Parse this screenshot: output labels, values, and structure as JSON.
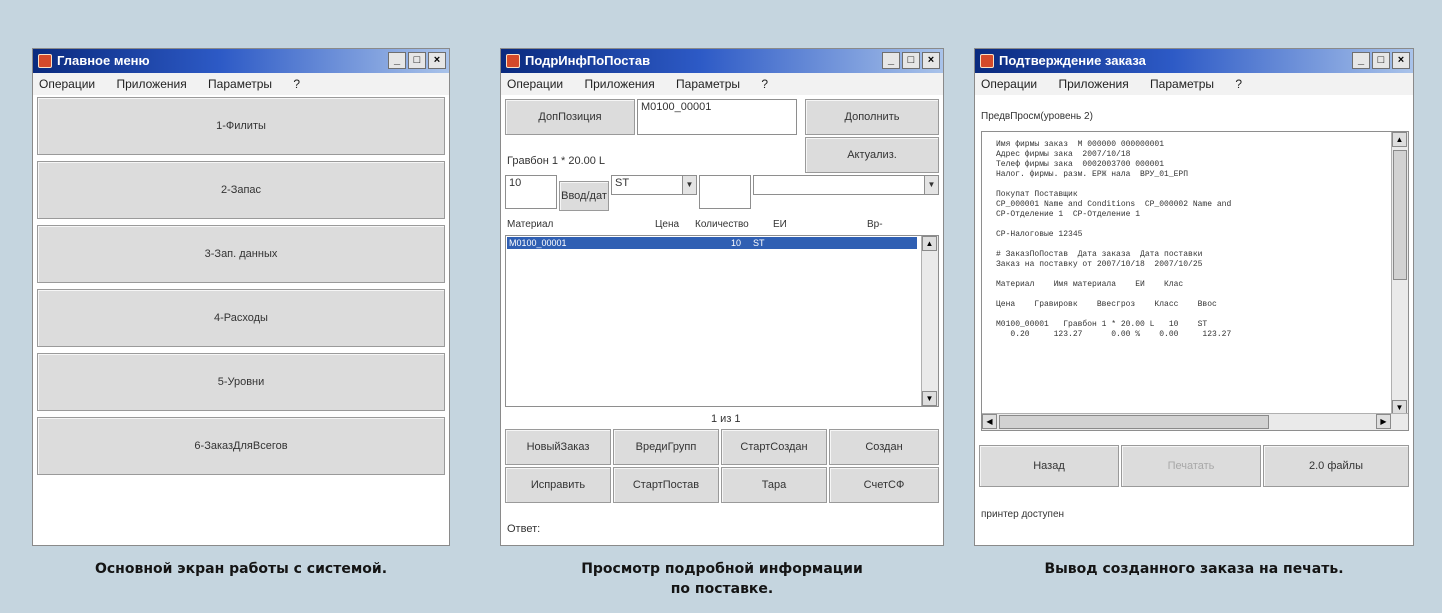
{
  "captions": {
    "main": "Основной экран работы с системой.",
    "details_line1": "Просмотр подробной информации",
    "details_line2": "по поставке.",
    "print": "Вывод созданного заказа на печать."
  },
  "main_window": {
    "title": "Главное меню",
    "menu": [
      "Операции",
      "Приложения",
      "Параметры",
      "?"
    ],
    "buttons": [
      "1-Филиты",
      "2-Запас",
      "3-Зап. данных",
      "4-Расходы",
      "5-Уровни",
      "6-ЗаказДляВсегов"
    ]
  },
  "details_window": {
    "title": "ПодрИнфПоПостав",
    "menu": [
      "Операции",
      "Приложения",
      "Параметры",
      "?"
    ],
    "btn_details": "ДопПозиция",
    "order_field": "M0100_00001",
    "btn_add": "Дополнить",
    "info_label": "Гравбон 1 * 20.00 L",
    "btn_update": "Актуализ.",
    "qty_field": "10",
    "btn_read": "Ввод/дат",
    "combo_value": "ST",
    "table_headers": [
      "Материал",
      "Цена",
      "Количество",
      "ЕИ",
      "Вр-"
    ],
    "table_rows": [
      {
        "material": "M0100_00001",
        "qty": "10",
        "unit": "ST"
      }
    ],
    "pager": "1 из 1",
    "actions_row1": [
      "НовыйЗаказ",
      "ВредиГрупп",
      "СтартСоздан",
      "Создан"
    ],
    "actions_row2": [
      "Исправить",
      "СтартПостав",
      "Тара",
      "СчетСФ"
    ],
    "status": "Ответ:"
  },
  "print_window": {
    "title": "Подтверждение заказа",
    "menu": [
      "Операции",
      "Приложения",
      "Параметры",
      "?"
    ],
    "label_top": "ПредвПросм(уровень 2)",
    "report_lines": [
      "Имя фирмы заказ  M 000000 000000001",
      "Адрес фирмы зака  2007/10/18",
      "Телеф фирмы зака  0002003700 000001",
      "Налог. фирмы. разм. ЕРЖ нала  ВРУ_01_ЕРП",
      "",
      "Покупат Поставщик",
      "СР_000001 Name and Conditions  СР_000002 Name and",
      "СР-Отделение 1  СР-Отделение 1",
      "",
      "СР-Налоговые 12345",
      "",
      "# ЗаказПоПостав  Дата заказа  Дата поставки",
      "Заказ на поставку от 2007/10/18  2007/10/25",
      "",
      "Материал    Имя материала    ЕИ    Клас",
      "",
      "Цена    Гравировк    Ввесгроз    Класс    Ввос",
      "",
      "M0100_00001   Гравбон 1 * 20.00 L   10    ST",
      "   0.20     123.27      0.00 %    0.00     123.27"
    ],
    "btn_back": "Назад",
    "btn_print": "Печатать",
    "btn_file": "2.0 файлы",
    "status": "принтер доступен"
  }
}
